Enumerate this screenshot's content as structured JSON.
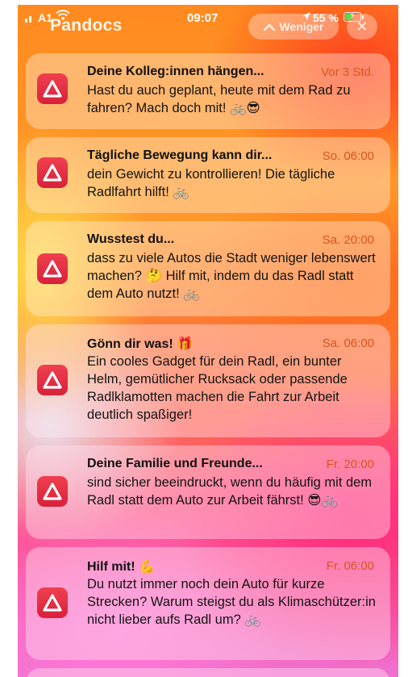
{
  "status_bar": {
    "carrier": "A1",
    "time": "09:07",
    "battery_percent": "55 %",
    "app_name": "Pandocs",
    "less_button": "Weniger",
    "close_symbol": "✕",
    "wifi_icon": "wifi-icon",
    "battery_level": 0.55,
    "battery_color": "#5dd84a"
  },
  "app": {
    "icon_color": "#e2283f",
    "timestamp_color": "#d8541e"
  },
  "notifications": [
    {
      "title": "Deine Kolleg:innen hängen...",
      "timestamp": "Vor 3 Std.",
      "body": "Hast du auch geplant, heute mit dem Rad zu fahren? Mach doch mit! 🚲😎"
    },
    {
      "title": "Tägliche Bewegung kann dir...",
      "timestamp": "So. 06:00",
      "body": "dein Gewicht zu kontrollieren! Die tägliche Radlfahrt hilft! 🚲"
    },
    {
      "title": "Wusstest du...",
      "timestamp": "Sa. 20:00",
      "body": "dass zu viele Autos die Stadt weniger lebenswert machen? 🤔 Hilf mit, indem du das Radl statt dem Auto nutzt! 🚲"
    },
    {
      "title": "Gönn dir was! 🎁",
      "timestamp": "Sa. 06:00",
      "body": "Ein cooles Gadget für dein Radl, ein bunter Helm, gemütlicher Rucksack oder passende Radlklamotten machen die Fahrt zur Arbeit deutlich spaßiger!"
    },
    {
      "title": "Deine Familie und Freunde...",
      "timestamp": "Fr. 20:00",
      "body": "sind sicher beeindruckt, wenn du häufig mit dem Radl statt dem Auto zur Arbeit fährst! 😎🚲"
    },
    {
      "title": "Hilf mit! 💪",
      "timestamp": "Fr. 06:00",
      "body": "Du nutzt immer noch dein Auto für kurze Strecken? Warum steigst du als Klimaschützer:in nicht lieber aufs Radl um? 🚲"
    }
  ]
}
